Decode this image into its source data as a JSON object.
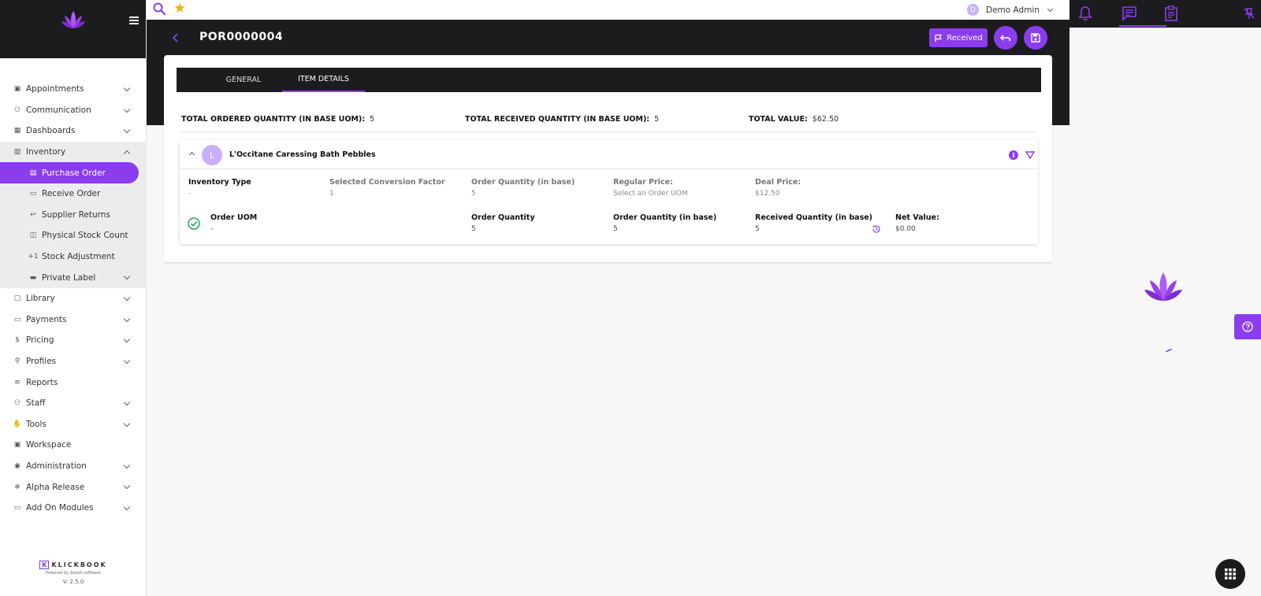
{
  "header": {
    "title": "POR0000004",
    "received_label": "Received"
  },
  "user": {
    "initial": "D",
    "name": "Demo Admin"
  },
  "sidebar": {
    "items": [
      {
        "label": "Appointments",
        "icon": "calendar-icon"
      },
      {
        "label": "Communication",
        "icon": "people-icon"
      },
      {
        "label": "Dashboards",
        "icon": "dashboard-icon"
      },
      {
        "label": "Inventory",
        "icon": "inventory-icon"
      },
      {
        "label": "Library",
        "icon": "library-icon"
      },
      {
        "label": "Payments",
        "icon": "payments-icon"
      },
      {
        "label": "Pricing",
        "icon": "dollar-icon"
      },
      {
        "label": "Profiles",
        "icon": "profile-icon"
      },
      {
        "label": "Reports",
        "icon": "reports-icon"
      },
      {
        "label": "Staff",
        "icon": "staff-icon"
      },
      {
        "label": "Tools",
        "icon": "tools-icon"
      },
      {
        "label": "Workspace",
        "icon": "workspace-icon"
      },
      {
        "label": "Administration",
        "icon": "admin-icon"
      },
      {
        "label": "Alpha Release",
        "icon": "snowflake-icon"
      },
      {
        "label": "Add On Modules",
        "icon": "folder-icon"
      }
    ],
    "inventory_sub": [
      {
        "label": "Purchase Order",
        "icon": "document-icon"
      },
      {
        "label": "Receive Order",
        "icon": "folder-icon"
      },
      {
        "label": "Supplier Returns",
        "icon": "return-icon"
      },
      {
        "label": "Physical Stock Count",
        "icon": "stock-icon"
      },
      {
        "label": "Stock Adjustment",
        "icon": "plus-one-icon"
      },
      {
        "label": "Private Label",
        "icon": "label-icon"
      }
    ],
    "brand_name": "KLICKBOOK",
    "brand_sub": "Powered by Zenoti software",
    "version": "V: 2.5.0"
  },
  "tabs": [
    {
      "label": "GENERAL"
    },
    {
      "label": "ITEM DETAILS"
    }
  ],
  "totals": {
    "ordered_label": "TOTAL ORDERED QUANTITY (IN BASE UOM):",
    "ordered_value": "5",
    "received_label": "TOTAL RECEIVED QUANTITY (IN BASE UOM):",
    "received_value": "5",
    "value_label": "TOTAL VALUE:",
    "value_value": "$62.50"
  },
  "item": {
    "initial": "L",
    "name": "L'Occitane Caressing Bath Pebbles",
    "inventory_type_label": "Inventory Type",
    "inventory_type_value": "-",
    "conversion_label": "Selected Conversion Factor",
    "conversion_value": "1",
    "order_qty_base_label": "Order Quantity (in base)",
    "order_qty_base_value": "5",
    "regular_price_label": "Regular Price:",
    "regular_price_value": "Select an Order UOM",
    "deal_price_label": "Deal Price:",
    "deal_price_value": "$12.50",
    "order_uom_label": "Order UOM",
    "order_uom_value": "-",
    "order_qty_label": "Order Quantity",
    "order_qty_value": "5",
    "order_qty_base2_label": "Order Quantity (in base)",
    "order_qty_base2_value": "5",
    "received_qty_label": "Received Quantity (in base)",
    "received_qty_value": "5",
    "net_value_label": "Net Value:",
    "net_value_value": "$0.00"
  },
  "colors": {
    "accent": "#8b3dee",
    "dark": "#1c1c1f",
    "star": "#f5b40a"
  }
}
